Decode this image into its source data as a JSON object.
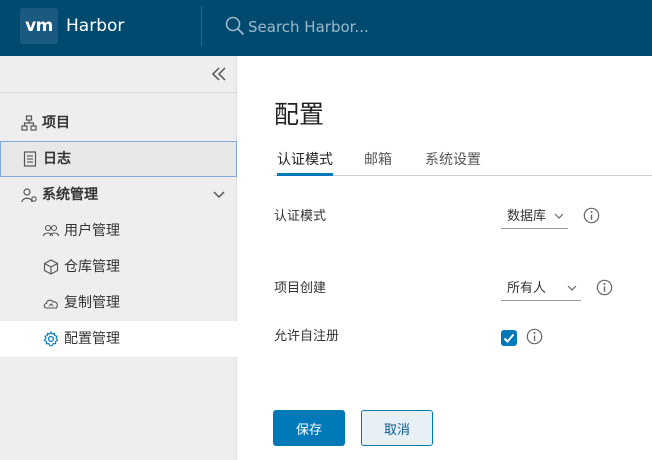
{
  "header": {
    "logo_text": "vm",
    "brand": "Harbor",
    "search_placeholder": "Search Harbor..."
  },
  "sidebar": {
    "items": [
      {
        "label": "项目",
        "icon": "project-icon"
      },
      {
        "label": "日志",
        "icon": "log-icon"
      },
      {
        "label": "系统管理",
        "icon": "admin-icon",
        "expanded": true,
        "children": [
          {
            "label": "用户管理",
            "icon": "users-icon"
          },
          {
            "label": "仓库管理",
            "icon": "repository-icon"
          },
          {
            "label": "复制管理",
            "icon": "replication-icon"
          },
          {
            "label": "配置管理",
            "icon": "gear-icon",
            "active": true
          }
        ]
      }
    ]
  },
  "main": {
    "title": "配置",
    "tabs": [
      "认证模式",
      "邮箱",
      "系统设置"
    ],
    "active_tab": "认证模式",
    "form": {
      "auth_mode": {
        "label": "认证模式",
        "value": "数据库"
      },
      "project_creation": {
        "label": "项目创建",
        "value": "所有人"
      },
      "self_registration": {
        "label": "允许自注册",
        "checked": true
      }
    },
    "buttons": {
      "save": "保存",
      "cancel": "取消"
    }
  },
  "colors": {
    "header_bg": "#004a70",
    "accent": "#0079b8",
    "sidebar_bg": "#eeeeee"
  }
}
